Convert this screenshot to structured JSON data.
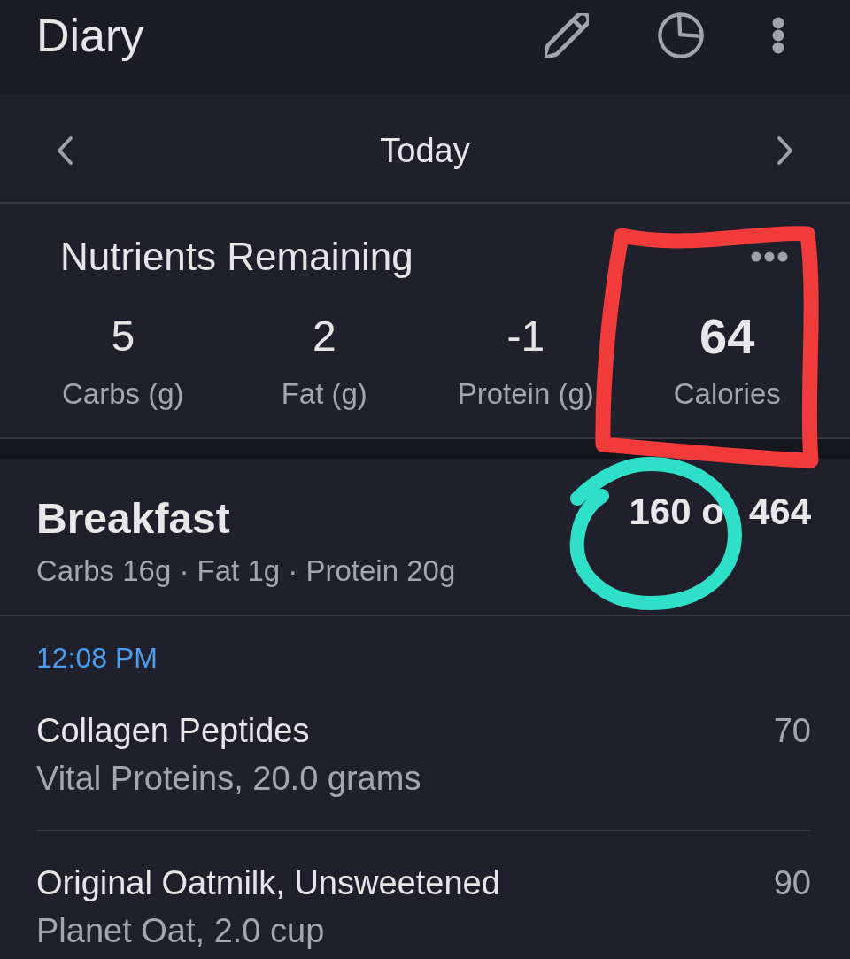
{
  "app_bar": {
    "title": "Diary"
  },
  "date_nav": {
    "label": "Today"
  },
  "nutrients_remaining": {
    "title": "Nutrients Remaining",
    "items": [
      {
        "kind": "macro",
        "value": "5",
        "label": "Carbs (g)"
      },
      {
        "kind": "macro",
        "value": "2",
        "label": "Fat (g)"
      },
      {
        "kind": "macro",
        "value": "-1",
        "label": "Protein (g)"
      },
      {
        "kind": "total",
        "value": "64",
        "label": "Calories"
      }
    ]
  },
  "meal": {
    "name": "Breakfast",
    "summary": "Carbs 16g · Fat 1g · Protein 20g",
    "calories_visible_parts": [
      "160 o",
      "464"
    ],
    "time": "12:08 PM",
    "entries": [
      {
        "name": "Collagen Peptides",
        "detail": "Vital Proteins, 20.0 grams",
        "calories": "70"
      },
      {
        "name": "Original Oatmilk, Unsweetened",
        "detail": "Planet Oat, 2.0 cup",
        "calories": "90"
      }
    ]
  },
  "annotations": [
    {
      "kind": "rectangle",
      "color": "#f23b3b"
    },
    {
      "kind": "circle",
      "color": "#2fe0c8"
    }
  ]
}
